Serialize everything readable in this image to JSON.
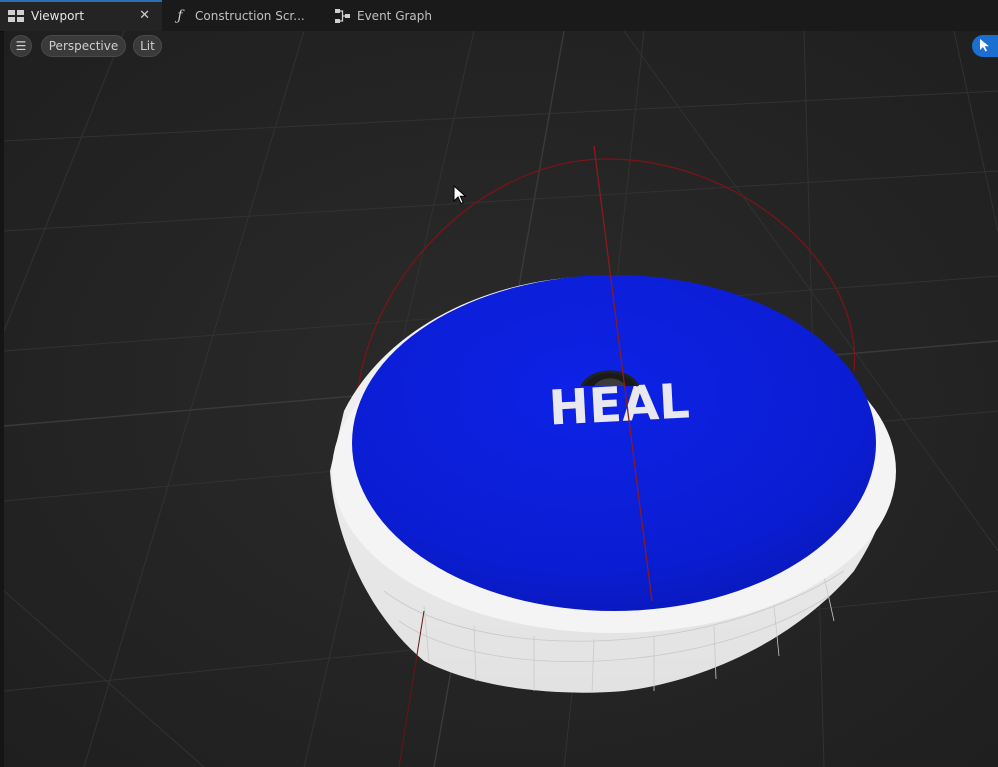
{
  "tabs": [
    {
      "label": "Viewport",
      "icon": "viewport-icon",
      "active": true
    },
    {
      "label": "Construction Scr...",
      "icon": "function-icon",
      "active": false
    },
    {
      "label": "Event Graph",
      "icon": "graph-icon",
      "active": false
    }
  ],
  "toolbar": {
    "menu_icon": "hamburger-icon",
    "view_mode": "Perspective",
    "lighting_mode": "Lit",
    "select_tool_icon": "select-arrow-icon"
  },
  "scene": {
    "pad_label": "HEAL",
    "pad_color": "#0c1fd8",
    "rim_color": "#f0f0f0",
    "bounds_color": "#7a1418"
  },
  "colors": {
    "accent": "#1b6fd1",
    "viewport_bg": "#262626"
  }
}
